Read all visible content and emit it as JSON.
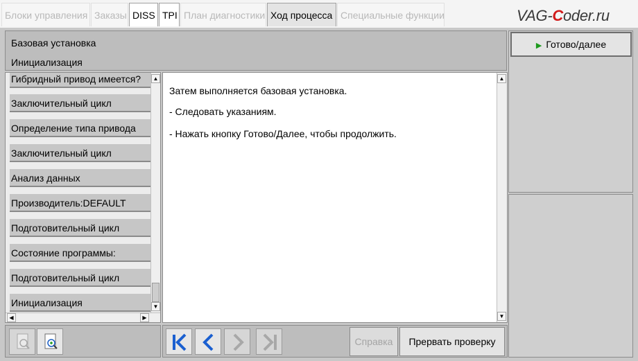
{
  "tabs": [
    {
      "label": "Блоки управления",
      "state": "disabled"
    },
    {
      "label": "Заказы",
      "state": "disabled"
    },
    {
      "label": "DISS",
      "state": "enabled"
    },
    {
      "label": "TPI",
      "state": "enabled"
    },
    {
      "label": "План диагностики",
      "state": "disabled"
    },
    {
      "label": "Ход процесса",
      "state": "active"
    },
    {
      "label": "Специальные функции",
      "state": "disabled"
    }
  ],
  "logo": {
    "prefix": "VAG-",
    "accent": "C",
    "suffix": "oder.ru",
    "accent_color": "#d21a1a"
  },
  "header": {
    "line1": "Базовая установка",
    "line2": "Инициализация"
  },
  "steps": [
    "Гибридный привод имеется?",
    "Заключительный цикл",
    "Определение типа привода",
    "Заключительный цикл",
    "Анализ данных",
    "Производитель:DEFAULT",
    "Подготовительный цикл",
    "Состояние программы:",
    "Подготовительный цикл",
    "Инициализация"
  ],
  "instructions": [
    "Затем выполняется базовая установка.",
    "- Следовать указаниям.",
    "- Нажать кнопку Готово/Далее, чтобы продолжить."
  ],
  "actions": {
    "ready_label": "Готово/далее",
    "help_label": "Справка",
    "abort_label": "Прервать проверку"
  },
  "icons": {
    "zoom_out": "zoom-out-icon",
    "zoom_in": "zoom-in-icon",
    "first": "skip-first-icon",
    "prev": "chevron-left-icon",
    "next": "chevron-right-icon",
    "last": "skip-last-icon",
    "play": "play-icon"
  },
  "colors": {
    "accent_blue": "#1a5fd0",
    "play_green": "#1e9a1e"
  }
}
